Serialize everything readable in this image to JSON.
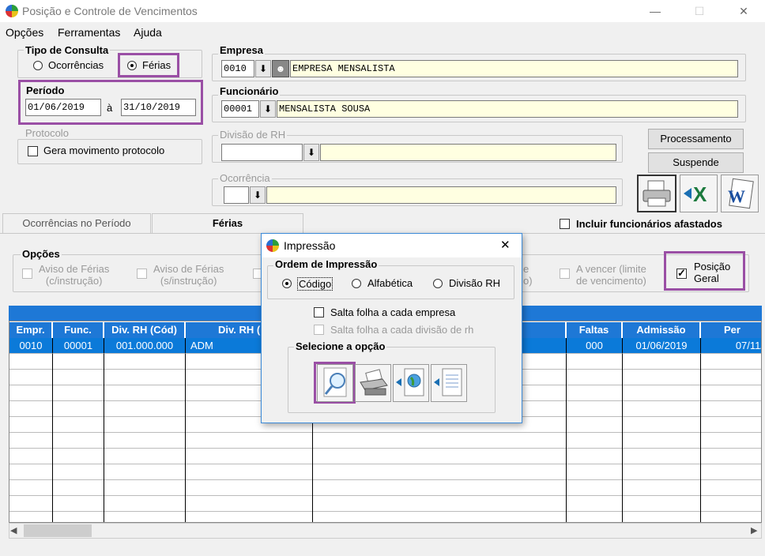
{
  "window": {
    "title": "Posição e Controle de Vencimentos",
    "minimize": "—",
    "maximize": "☐",
    "close": "✕"
  },
  "menu": [
    "Opções",
    "Ferramentas",
    "Ajuda"
  ],
  "tipo": {
    "label": "Tipo de Consulta",
    "ocorrencias": "Ocorrências",
    "ferias": "Férias"
  },
  "periodo": {
    "label": "Período",
    "start": "01/06/2019",
    "sep": "à",
    "end": "31/10/2019"
  },
  "protocolo": {
    "label": "Protocolo",
    "check": "Gera movimento protocolo"
  },
  "empresa": {
    "label": "Empresa",
    "code": "0010",
    "name": "EMPRESA MENSALISTA"
  },
  "funcionario": {
    "label": "Funcionário",
    "code": "00001",
    "name": "MENSALISTA SOUSA"
  },
  "divisao": {
    "label": "Divisão de RH",
    "code": "",
    "name": ""
  },
  "ocorrencia": {
    "label": "Ocorrência",
    "code": "",
    "name": ""
  },
  "buttons": {
    "processamento": "Processamento",
    "suspende": "Suspende",
    "download": "⬇"
  },
  "tabs": {
    "t1": "Ocorrências no Período",
    "t2": "Férias"
  },
  "incluir": "Incluir funcionários afastados",
  "opcoes": {
    "label": "Opções",
    "a1": "Aviso de Férias",
    "a1b": "(c/instrução)",
    "a2": "Aviso de Férias",
    "a2b": "(s/instrução)",
    "partial": "e",
    "partial2": "o)",
    "avencer1": "A vencer (limite",
    "avencer2": "de vencimento)",
    "pos1": "Posição",
    "pos2": "Geral"
  },
  "table": {
    "headers": [
      "Empr.",
      "Func.",
      "Div. RH (Cód)",
      "Div. RH (Des",
      "Faltas",
      "Admissão",
      "Per"
    ],
    "row": [
      "0010",
      "00001",
      "001.000.000",
      "ADM",
      "000",
      "01/06/2019",
      "07/11/"
    ]
  },
  "scroll": {
    "left": "◀",
    "right": "▶"
  },
  "dialog": {
    "title": "Impressão",
    "close": "✕",
    "ordem": "Ordem de Impressão",
    "codigo": "Código",
    "alfabetica": "Alfabética",
    "divisao": "Divisão RH",
    "salta1": "Salta folha a cada empresa",
    "salta2": "Salta folha a cada divisão de rh",
    "selecione": "Selecione a opção"
  }
}
